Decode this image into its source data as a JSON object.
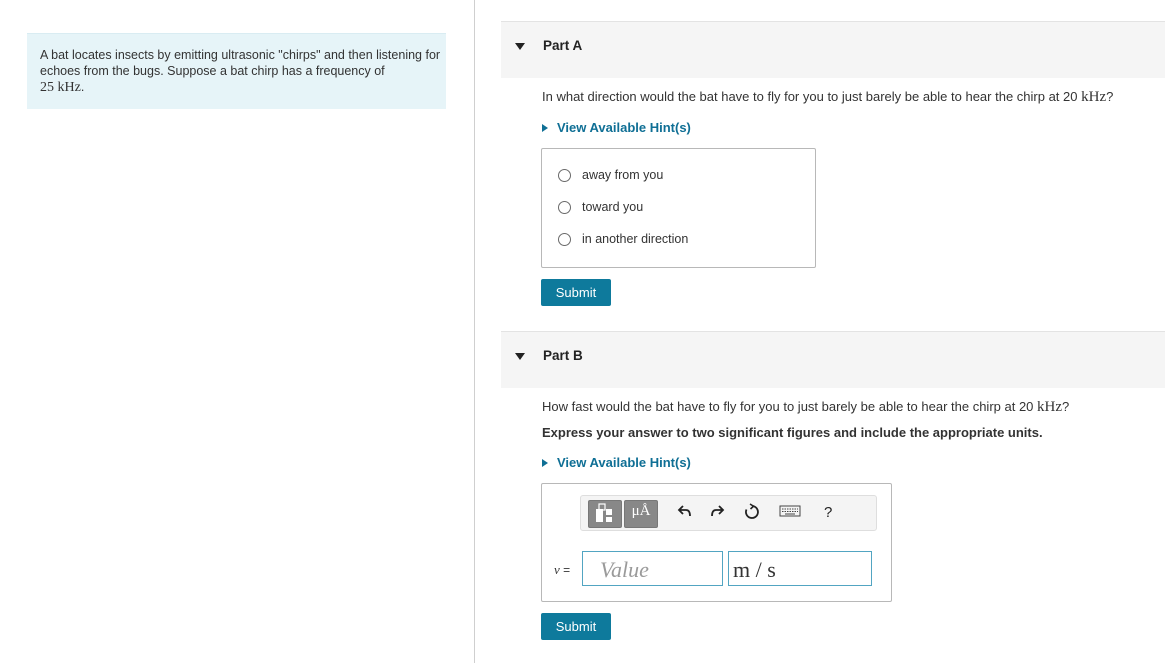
{
  "intro": {
    "text_before": "A bat locates insects by emitting ultrasonic \"chirps\" and then listening for echoes from the bugs. Suppose a bat chirp has a frequency of",
    "freq_value": "25",
    "freq_unit": "kHz",
    "text_after": "."
  },
  "part_a": {
    "label": "Part A",
    "question_before": "In what direction would the bat have to fly for you to just barely be able to hear the chirp at 20",
    "question_unit": "kHz",
    "question_after": "?",
    "hint": "View Available Hint(s)",
    "choices": [
      "away from you",
      "toward you",
      "in another direction"
    ],
    "submit": "Submit"
  },
  "part_b": {
    "label": "Part B",
    "question_before": "How fast would the bat have to fly for you to just barely be able to hear the chirp at 20",
    "question_unit": "kHz",
    "question_after": "?",
    "instructions": "Express your answer to two significant figures and include the appropriate units.",
    "hint": "View Available Hint(s)",
    "toolbar": {
      "units_label": "μÅ",
      "help": "?"
    },
    "variable": "v",
    "equals": " =",
    "value_placeholder": "Value",
    "units_value": "m / s",
    "submit": "Submit"
  },
  "icons": [
    "templates-icon",
    "units-icon",
    "undo-icon",
    "redo-icon",
    "reset-icon",
    "keyboard-icon",
    "help-icon",
    "expand-triangle-icon",
    "hint-triangle-icon"
  ],
  "colors": {
    "accent": "#0e7a9c",
    "link": "#0f6f95",
    "intro_bg": "#e6f4f8",
    "input_border": "#52a5c2"
  }
}
